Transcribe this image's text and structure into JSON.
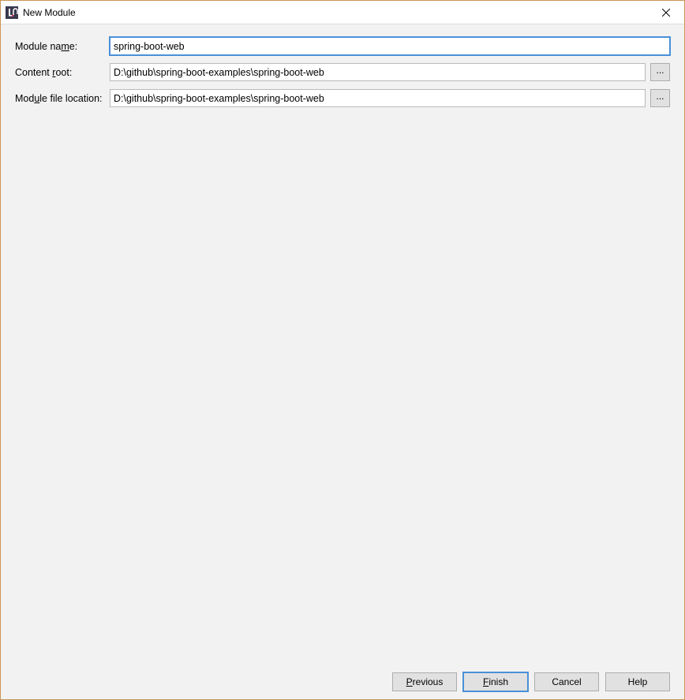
{
  "window": {
    "title": "New Module"
  },
  "form": {
    "module_name": {
      "label_pre": "Module na",
      "label_ul": "m",
      "label_post": "e:",
      "value": "spring-boot-web"
    },
    "content_root": {
      "label_pre": "Content ",
      "label_ul": "r",
      "label_post": "oot:",
      "value": "D:\\github\\spring-boot-examples\\spring-boot-web",
      "browse": "..."
    },
    "module_file_location": {
      "label_pre": "Mod",
      "label_ul": "u",
      "label_post": "le file location:",
      "value": "D:\\github\\spring-boot-examples\\spring-boot-web",
      "browse": "..."
    }
  },
  "buttons": {
    "previous": {
      "ul": "P",
      "rest": "revious"
    },
    "finish": {
      "ul": "F",
      "rest": "inish"
    },
    "cancel": {
      "label": "Cancel"
    },
    "help": {
      "label": "Help"
    }
  }
}
